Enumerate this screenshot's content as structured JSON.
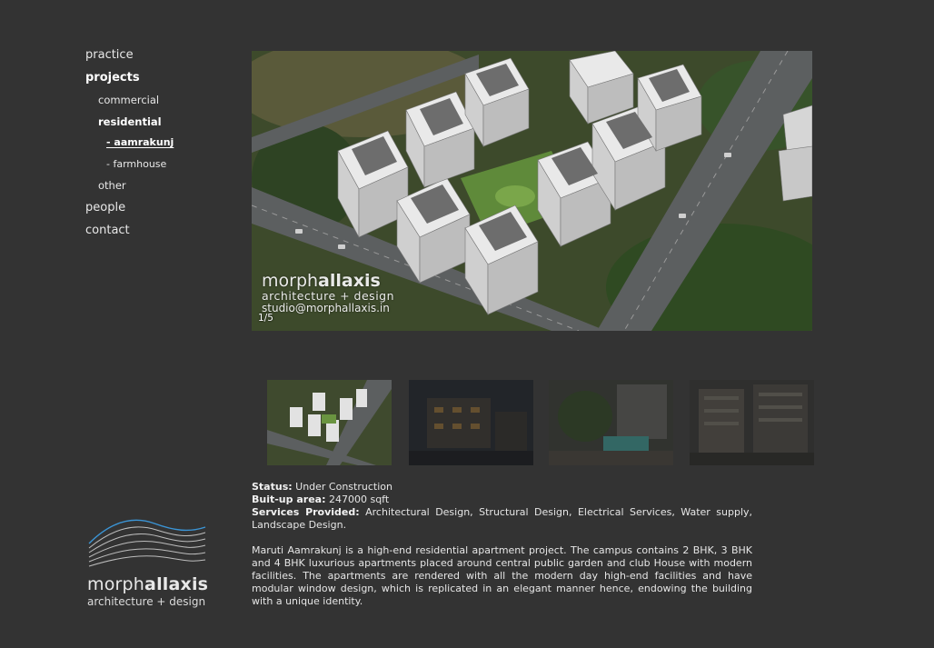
{
  "nav": {
    "practice": "practice",
    "projects": "projects",
    "commercial": "commercial",
    "residential": "residential",
    "aamrakunj": "- aamrakunj",
    "farmhouse": "- farmhouse",
    "other": "other",
    "people": "people",
    "contact": "contact"
  },
  "logo": {
    "name_light": "morph",
    "name_bold": "allaxis",
    "tagline": "architecture + design"
  },
  "slideshow": {
    "watermark_light": "morph",
    "watermark_bold": "allaxis",
    "watermark_sub": "architecture + design",
    "watermark_email": "studio@morphallaxis.in",
    "counter": "1/5"
  },
  "thumbnails": [
    {
      "label": "thumbnail 1 aerial view"
    },
    {
      "label": "thumbnail 2 night view"
    },
    {
      "label": "thumbnail 3 pool view"
    },
    {
      "label": "thumbnail 4 facade view"
    }
  ],
  "details": {
    "status_label": "Status:",
    "status_value": " Under Construction",
    "area_label": "Buit-up area:",
    "area_value": " 247000 sqft",
    "services_label": "Services Provided:",
    "services_value": " Architectural Design, Structural Design, Electrical Services, Water supply, Landscape Design.",
    "description": "Maruti Aamrakunj is a high-end residential apartment project. The campus contains 2 BHK, 3 BHK and 4 BHK luxurious apartments placed around central public garden and club House with modern facilities. The apartments are rendered with all the modern day high-end facilities and have modular window design, which is replicated in an elegant manner hence, endowing the building with a unique identity."
  }
}
